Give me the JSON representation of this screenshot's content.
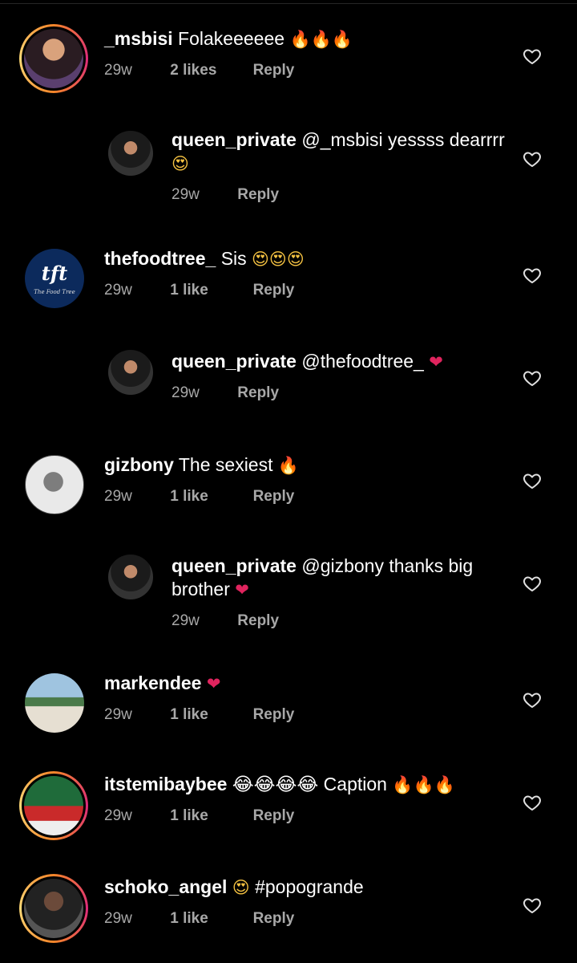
{
  "comments": [
    {
      "username": "_msbisi",
      "text": "Folakeeeeee ",
      "emoji": "🔥🔥🔥",
      "time": "29w",
      "likes": "2 likes",
      "reply": "Reply"
    },
    {
      "username": "queen_private",
      "text": "@_msbisi yessss dearrrr",
      "emoji": "😍",
      "time": "29w",
      "reply": "Reply"
    },
    {
      "username": "thefoodtree_",
      "text": "Sis ",
      "emoji": "😍😍😍",
      "time": "29w",
      "likes": "1 like",
      "reply": "Reply",
      "avatar_text": "tft",
      "avatar_caption": "The Food Tree"
    },
    {
      "username": "queen_private",
      "text": "@thefoodtree_ ",
      "emoji": "❤",
      "time": "29w",
      "reply": "Reply"
    },
    {
      "username": "gizbony",
      "text": "The sexiest ",
      "emoji": "🔥",
      "time": "29w",
      "likes": "1 like",
      "reply": "Reply"
    },
    {
      "username": "queen_private",
      "text": "@gizbony thanks big brother ",
      "emoji": "❤",
      "time": "29w",
      "reply": "Reply"
    },
    {
      "username": "markendee",
      "text": "",
      "emoji": "❤",
      "time": "29w",
      "likes": "1 like",
      "reply": "Reply"
    },
    {
      "username": "itstemibaybee",
      "text": "😂😂😂😂 Caption ",
      "emoji": "🔥🔥🔥",
      "time": "29w",
      "likes": "1 like",
      "reply": "Reply"
    },
    {
      "username": "schoko_angel",
      "text": "",
      "emoji": "😍",
      "text_after": " #popogrande",
      "time": "29w",
      "likes": "1 like",
      "reply": "Reply"
    }
  ],
  "colors": {
    "background": "#000000",
    "secondary_text": "#a8a8a8",
    "story_ring": "#dd2a7b"
  }
}
